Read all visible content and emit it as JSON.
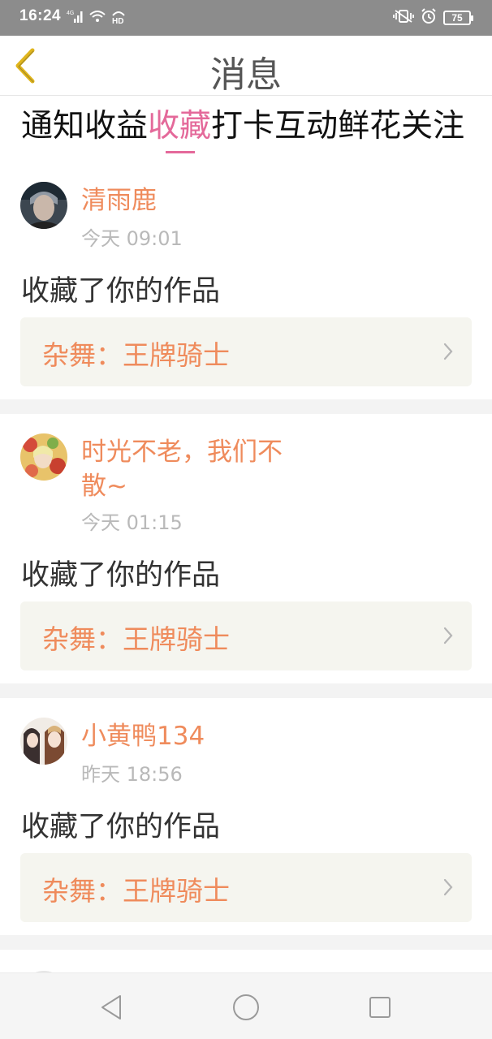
{
  "status_bar": {
    "time": "16:24",
    "network": "4G",
    "hd": "HD",
    "battery": "75"
  },
  "header": {
    "title": "消息"
  },
  "tabs": [
    {
      "label": "通知"
    },
    {
      "label": "收益"
    },
    {
      "label": "收藏",
      "active": true
    },
    {
      "label": "打卡"
    },
    {
      "label": "互动"
    },
    {
      "label": "鲜花"
    },
    {
      "label": "关注"
    }
  ],
  "notifications": [
    {
      "username": "清雨鹿",
      "time": "今天 09:01",
      "action": "收藏了你的作品",
      "work": "杂舞：王牌骑士"
    },
    {
      "username_line1": "时光不老，我们不",
      "username_line2": "散~",
      "time": "今天 01:15",
      "action": "收藏了你的作品",
      "work": "杂舞：王牌骑士"
    },
    {
      "username": "小黄鸭134",
      "time": "昨天 18:56",
      "action": "收藏了你的作品",
      "work": "杂舞：王牌骑士"
    }
  ],
  "colors": {
    "accent_pink": "#e4699a",
    "username_orange": "#ef8b5c",
    "back_arrow_yellow": "#e0b51c",
    "work_box_bg": "#f5f5ef"
  },
  "icons": {
    "back": "chevron-left-icon",
    "work_arrow": "chevron-right-icon",
    "nav_back": "triangle-back-icon",
    "nav_home": "circle-home-icon",
    "nav_recent": "square-recent-icon"
  }
}
